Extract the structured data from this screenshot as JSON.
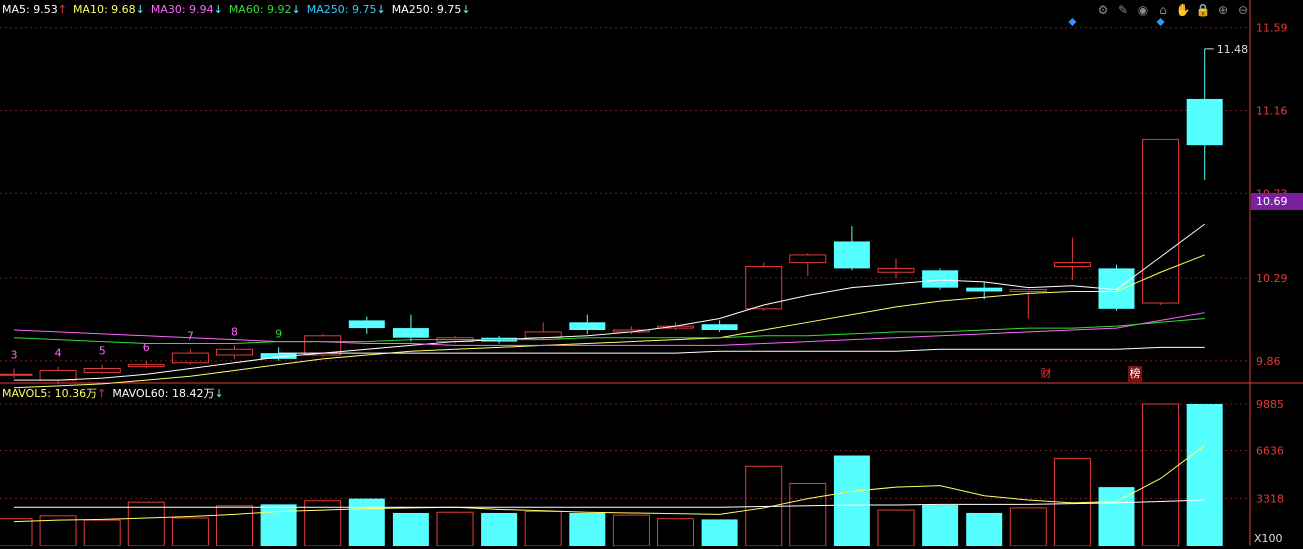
{
  "price_legend": [
    {
      "label": "MA5: 9.53",
      "arrow": "↑",
      "color": "#ffffff"
    },
    {
      "label": "MA10: 9.68",
      "arrow": "↓",
      "color": "#ffff66"
    },
    {
      "label": "MA30: 9.94",
      "arrow": "↓",
      "color": "#ff66ff"
    },
    {
      "label": "MA60: 9.92",
      "arrow": "↓",
      "color": "#33dd33"
    },
    {
      "label": "MA250: 9.75",
      "arrow": "↓",
      "color": "#33ccff"
    },
    {
      "label": "MA250: 9.75",
      "arrow": "↓",
      "color": "#ffffff"
    }
  ],
  "volume_legend": [
    {
      "label": "MAVOL5: 10.36万",
      "arrow": "↑",
      "color": "#ffff66"
    },
    {
      "label": "MAVOL60: 18.42万",
      "arrow": "↓",
      "color": "#ffffff"
    }
  ],
  "toolbar_icons": [
    "settings-icon",
    "pen-icon",
    "eye-icon",
    "shop-icon",
    "hand-icon",
    "lock-icon",
    "zoom-in-icon",
    "zoom-out-icon"
  ],
  "toolbar_glyphs": [
    "⚙",
    "✎",
    "◉",
    "⌂",
    "✋",
    "🔒",
    "⊕",
    "⊖"
  ],
  "colors": {
    "up": "#e33b3b",
    "down": "#55ffff",
    "grid": "#7a1f1f",
    "axis": "#e33b3b",
    "price_badge": "#7a1fa0"
  },
  "markers": {
    "cai": "财",
    "bang": "榜"
  },
  "chart_data": [
    {
      "type": "candlestick",
      "y_ticks": [
        "11.59",
        "11.16",
        "10.73",
        "10.29",
        "9.86"
      ],
      "current_price": "10.69",
      "high_label": "11.48",
      "wave_labels": [
        {
          "text": "3",
          "i": 0
        },
        {
          "text": "4",
          "i": 1
        },
        {
          "text": "5",
          "i": 2
        },
        {
          "text": "6",
          "i": 3
        },
        {
          "text": "7",
          "i": 4
        },
        {
          "text": "8",
          "i": 5
        },
        {
          "text": "9",
          "i": 6
        }
      ],
      "candles": [
        {
          "o": 9.79,
          "c": 9.79,
          "h": 9.82,
          "l": 9.77
        },
        {
          "o": 9.76,
          "c": 9.81,
          "h": 9.83,
          "l": 9.74
        },
        {
          "o": 9.8,
          "c": 9.82,
          "h": 9.84,
          "l": 9.79
        },
        {
          "o": 9.83,
          "c": 9.84,
          "h": 9.86,
          "l": 9.82
        },
        {
          "o": 9.85,
          "c": 9.9,
          "h": 9.92,
          "l": 9.84
        },
        {
          "o": 9.89,
          "c": 9.92,
          "h": 9.94,
          "l": 9.87
        },
        {
          "o": 9.9,
          "c": 9.87,
          "h": 9.93,
          "l": 9.86
        },
        {
          "o": 9.89,
          "c": 9.99,
          "h": 10.0,
          "l": 9.88
        },
        {
          "o": 10.07,
          "c": 10.03,
          "h": 10.09,
          "l": 10.0
        },
        {
          "o": 10.03,
          "c": 9.98,
          "h": 10.1,
          "l": 9.96
        },
        {
          "o": 9.96,
          "c": 9.98,
          "h": 9.99,
          "l": 9.95
        },
        {
          "o": 9.98,
          "c": 9.96,
          "h": 9.99,
          "l": 9.95
        },
        {
          "o": 9.98,
          "c": 10.01,
          "h": 10.06,
          "l": 9.97
        },
        {
          "o": 10.06,
          "c": 10.02,
          "h": 10.1,
          "l": 10.0
        },
        {
          "o": 10.01,
          "c": 10.02,
          "h": 10.04,
          "l": 10.0
        },
        {
          "o": 10.03,
          "c": 10.04,
          "h": 10.06,
          "l": 10.02
        },
        {
          "o": 10.05,
          "c": 10.02,
          "h": 10.07,
          "l": 10.01
        },
        {
          "o": 10.13,
          "c": 10.35,
          "h": 10.37,
          "l": 10.12
        },
        {
          "o": 10.37,
          "c": 10.41,
          "h": 10.42,
          "l": 10.3
        },
        {
          "o": 10.48,
          "c": 10.34,
          "h": 10.56,
          "l": 10.33
        },
        {
          "o": 10.32,
          "c": 10.34,
          "h": 10.39,
          "l": 10.29
        },
        {
          "o": 10.33,
          "c": 10.24,
          "h": 10.34,
          "l": 10.23
        },
        {
          "o": 10.24,
          "c": 10.22,
          "h": 10.27,
          "l": 10.18
        },
        {
          "o": 10.22,
          "c": 10.23,
          "h": 10.23,
          "l": 10.08
        },
        {
          "o": 10.35,
          "c": 10.37,
          "h": 10.5,
          "l": 10.28
        },
        {
          "o": 10.34,
          "c": 10.13,
          "h": 10.36,
          "l": 10.12
        },
        {
          "o": 10.16,
          "c": 11.01,
          "h": 11.01,
          "l": 10.15
        },
        {
          "o": 11.22,
          "c": 10.98,
          "h": 11.48,
          "l": 10.8
        }
      ],
      "ma": [
        {
          "name": "MA5",
          "color": "#ffffff",
          "values": [
            9.76,
            9.76,
            9.77,
            9.79,
            9.82,
            9.85,
            9.88,
            9.9,
            9.92,
            9.94,
            9.96,
            9.97,
            9.98,
            9.99,
            10.01,
            10.04,
            10.08,
            10.15,
            10.2,
            10.24,
            10.26,
            10.28,
            10.27,
            10.24,
            10.25,
            10.23,
            10.4,
            10.57
          ]
        },
        {
          "name": "MA10",
          "color": "#ffff66",
          "values": [
            9.72,
            9.73,
            9.74,
            9.76,
            9.78,
            9.81,
            9.84,
            9.87,
            9.89,
            9.91,
            9.92,
            9.93,
            9.94,
            9.95,
            9.96,
            9.97,
            9.98,
            10.02,
            10.06,
            10.1,
            10.14,
            10.17,
            10.19,
            10.21,
            10.22,
            10.22,
            10.32,
            10.41
          ]
        },
        {
          "name": "MA30",
          "color": "#ff66ff",
          "values": [
            10.02,
            10.01,
            10.0,
            9.99,
            9.98,
            9.97,
            9.96,
            9.96,
            9.95,
            9.95,
            9.94,
            9.94,
            9.94,
            9.94,
            9.94,
            9.94,
            9.94,
            9.95,
            9.96,
            9.97,
            9.98,
            9.99,
            10.0,
            10.01,
            10.02,
            10.03,
            10.07,
            10.11
          ]
        },
        {
          "name": "MA60",
          "color": "#33dd33",
          "values": [
            9.98,
            9.97,
            9.96,
            9.95,
            9.95,
            9.95,
            9.96,
            9.96,
            9.96,
            9.97,
            9.97,
            9.97,
            9.97,
            9.98,
            9.98,
            9.98,
            9.98,
            9.99,
            9.99,
            10.0,
            10.01,
            10.01,
            10.02,
            10.03,
            10.03,
            10.04,
            10.06,
            10.08
          ]
        },
        {
          "name": "MA250",
          "color": "#ffffff",
          "values": [
            null,
            null,
            null,
            null,
            null,
            null,
            9.9,
            9.9,
            9.9,
            9.9,
            9.9,
            9.9,
            9.9,
            9.9,
            9.9,
            9.9,
            9.91,
            9.91,
            9.91,
            9.91,
            9.91,
            9.92,
            9.92,
            9.92,
            9.92,
            9.92,
            9.93,
            9.93
          ]
        }
      ],
      "ylim": [
        9.75,
        11.63
      ]
    },
    {
      "type": "bar",
      "y_ticks": [
        "9885",
        "6636",
        "3318"
      ],
      "unit_label": "X100",
      "volumes": [
        1900,
        2100,
        1800,
        3050,
        1950,
        2800,
        2900,
        3150,
        3300,
        2300,
        2350,
        2300,
        2400,
        2300,
        2150,
        1900,
        1850,
        5550,
        4350,
        6300,
        2500,
        2850,
        2300,
        2650,
        6100,
        4100,
        13000,
        13000
      ],
      "mavol5": [
        1700,
        1800,
        1850,
        1950,
        2050,
        2200,
        2400,
        2500,
        2600,
        2650,
        2700,
        2550,
        2450,
        2350,
        2300,
        2250,
        2200,
        2650,
        3300,
        3800,
        4100,
        4200,
        3500,
        3200,
        3000,
        3100,
        4700,
        7000
      ],
      "mavol60": [
        2700,
        2700,
        2700,
        2700,
        2700,
        2700,
        2700,
        2700,
        2700,
        2700,
        2700,
        2700,
        2700,
        2700,
        2700,
        2700,
        2700,
        2750,
        2800,
        2850,
        2850,
        2900,
        2900,
        2900,
        2950,
        3000,
        3100,
        3200
      ],
      "ylim": [
        0,
        9885
      ]
    }
  ]
}
